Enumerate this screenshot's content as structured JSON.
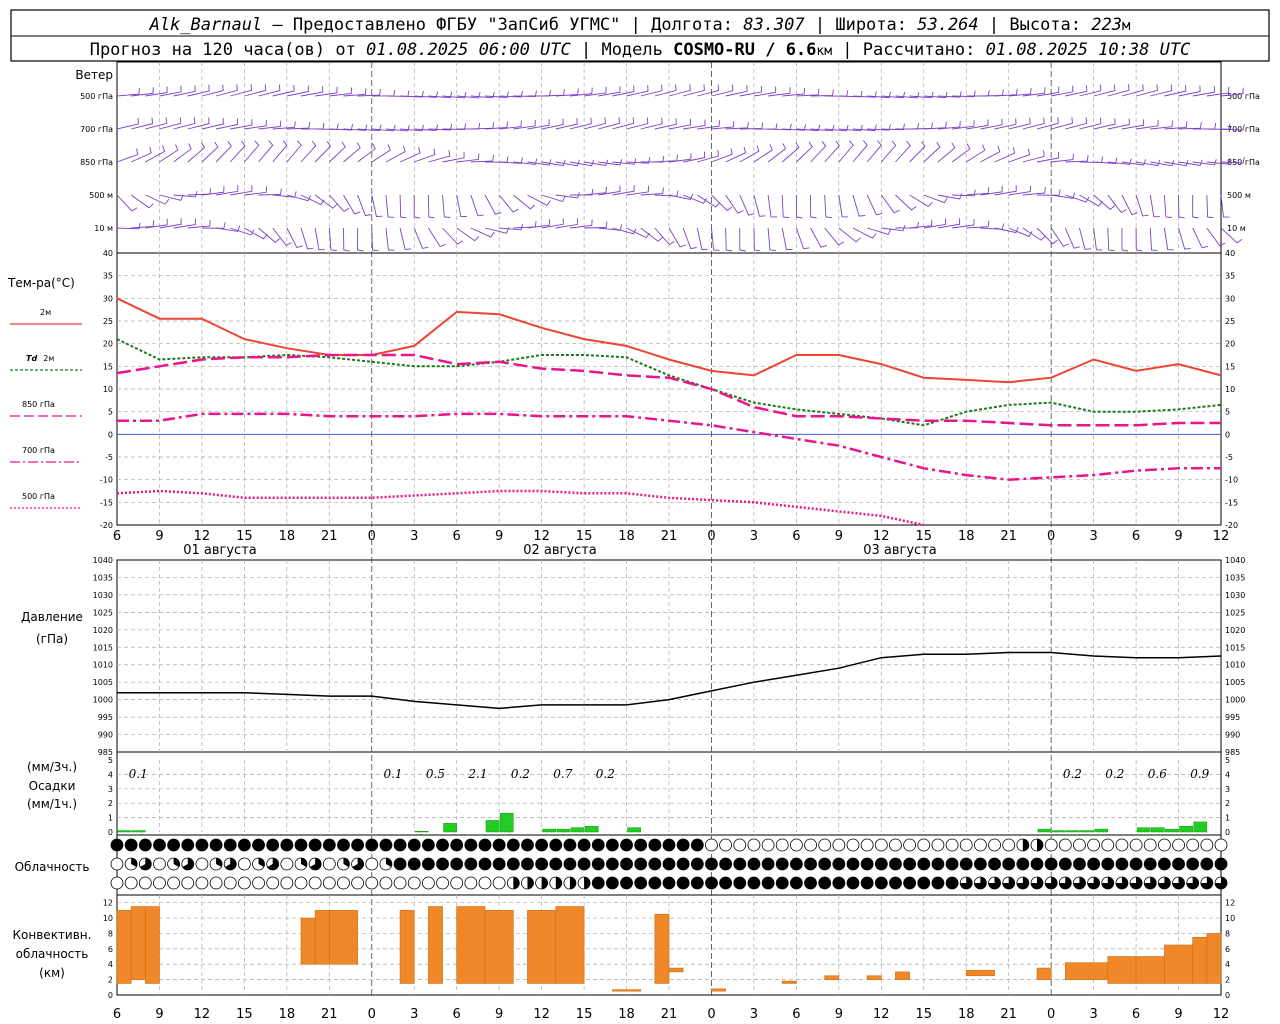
{
  "header": {
    "line1": {
      "station": "Alk_Barnaul",
      "provider": " – Предоставлено ФГБУ \"ЗапСиб УГМС\" | Долгота: ",
      "lon": "83.307",
      "lat_label": " | Широта: ",
      "lat": "53.264",
      "alt_label": " | Высота: ",
      "alt": "223",
      "alt_unit": "м"
    },
    "line2": {
      "prefix": "Прогноз на 120 часа(ов) от ",
      "from": "01.08.2025 06:00 UTC",
      "model_label": " | Модель ",
      "model": "COSMO-RU / 6.6",
      "model_unit": "км",
      "calc_label": " | Рассчитано: ",
      "calc": "01.08.2025 10:38 UTC"
    }
  },
  "labels": {
    "wind": "Ветер",
    "wind_levels": [
      "500 гПа",
      "700 гПа",
      "850 гПа",
      "500  м",
      "10   м"
    ],
    "temp": "Тем-ра(°С)",
    "t2m": "2м",
    "td2m_a": "Td",
    "td2m_b": "2м",
    "t850": "850 гПа",
    "t700": "700 гПа",
    "t500": "500 гПа",
    "pressure_a": "Давление",
    "pressure_b": "(гПа)",
    "precip_a": "(мм/3ч.)",
    "precip_b": "Осадки",
    "precip_c": "(мм/1ч.)",
    "cloud": "Облачность",
    "conv_a": "Конвективн.",
    "conv_b": "облачность",
    "conv_c": "(км)",
    "dates": [
      "01 августа",
      "02 августа",
      "03 августа"
    ]
  },
  "colors": {
    "wind": "#7b3fc4",
    "t2m": "#ee4433",
    "td2m": "#1a7a1a",
    "t850": "#e8168a",
    "t700": "#e8168a",
    "t500": "#e8168a",
    "zero": "#3344cc",
    "pressure": "#000000",
    "precip": "#22cc22",
    "conv": "#f0882a"
  },
  "chart_data": [
    {
      "type": "line",
      "id": "temperature",
      "ylim": [
        -20,
        40
      ],
      "yticks": [
        40,
        35,
        30,
        25,
        20,
        15,
        10,
        5,
        0,
        -5,
        -10,
        -15,
        -20
      ],
      "x_hours": [
        0,
        3,
        6,
        9,
        12,
        15,
        18,
        21,
        24,
        27,
        30,
        33,
        36,
        39,
        42,
        45,
        48,
        51,
        54,
        57,
        60,
        63,
        66,
        69,
        72,
        75,
        78
      ],
      "x_tick_labels": [
        "6",
        "9",
        "12",
        "15",
        "18",
        "21",
        "0",
        "3",
        "6",
        "9",
        "12",
        "15",
        "18",
        "21",
        "0",
        "3",
        "6",
        "9",
        "12",
        "15",
        "18",
        "21",
        "0",
        "3",
        "6",
        "9",
        "12"
      ],
      "series": [
        {
          "name": "2м",
          "values": [
            30,
            25.5,
            25.5,
            21,
            19,
            17.5,
            17.5,
            19.5,
            27,
            26.5,
            23.5,
            21,
            19.5,
            16.5,
            14,
            13,
            17.5,
            17.5,
            15.5,
            12.5,
            12,
            11.5,
            12.5,
            16.5,
            14,
            15.5,
            13
          ]
        },
        {
          "name": "Td 2м",
          "values": [
            21,
            16.5,
            17,
            17,
            17.5,
            17,
            16,
            15,
            15,
            16,
            17.5,
            17.5,
            17,
            13,
            10,
            7,
            5.5,
            4.5,
            3.5,
            2,
            5,
            6.5,
            7,
            5,
            5,
            5.5,
            6.5
          ]
        },
        {
          "name": "850 гПа",
          "values": [
            13.5,
            15,
            16.5,
            17,
            17,
            17.5,
            17.5,
            17.5,
            15.5,
            16,
            14.5,
            14,
            13,
            12.5,
            10,
            6,
            4,
            4,
            3.5,
            3,
            3,
            2.5,
            2,
            2,
            2,
            2.5,
            2.5
          ]
        },
        {
          "name": "700 гПа",
          "values": [
            3,
            3,
            4.5,
            4.5,
            4.5,
            4,
            4,
            4,
            4.5,
            4.5,
            4,
            4,
            4,
            3,
            2,
            0.5,
            -1,
            -2.5,
            -5,
            -7.5,
            -9,
            -10,
            -9.5,
            -9,
            -8,
            -7.5,
            -7.5
          ]
        },
        {
          "name": "500 гПа",
          "values": [
            -13,
            -12.5,
            -13,
            -14,
            -14,
            -14,
            -14,
            -13.5,
            -13,
            -12.5,
            -12.5,
            -13,
            -13,
            -14,
            -14.5,
            -15,
            -16,
            -17,
            -18,
            -20
          ]
        }
      ]
    },
    {
      "type": "line",
      "id": "pressure",
      "ylim": [
        985,
        1040
      ],
      "yticks": [
        1040,
        1035,
        1030,
        1025,
        1020,
        1015,
        1010,
        1005,
        1000,
        995,
        990,
        985
      ],
      "x_hours": [
        0,
        3,
        6,
        9,
        12,
        15,
        18,
        21,
        24,
        27,
        30,
        33,
        36,
        39,
        42,
        45,
        48,
        51,
        54,
        57,
        60,
        63,
        66,
        69,
        72,
        75,
        78
      ],
      "series": [
        {
          "name": "Давление",
          "values": [
            1002,
            1002,
            1002,
            1002,
            1001.5,
            1001,
            1001,
            999.5,
            998.5,
            997.5,
            998.5,
            998.5,
            998.5,
            1000,
            1002.5,
            1005,
            1007,
            1009,
            1012,
            1013,
            1013,
            1013.5,
            1013.5,
            1012.5,
            1012,
            1012,
            1012.5
          ]
        }
      ]
    },
    {
      "type": "bar",
      "id": "precipitation",
      "ylim": [
        0,
        5
      ],
      "yticks": [
        5,
        4,
        3,
        2,
        1,
        0
      ],
      "labels_3h": [
        "0.1",
        "0.1",
        "0.5",
        "2.1",
        "0.2",
        "0.7",
        "0.2",
        "0.2",
        "0.2",
        "0.6",
        "0.9"
      ],
      "labels_3h_hours": [
        1.5,
        19.5,
        22.5,
        25.5,
        28.5,
        31.5,
        34.5,
        67.5,
        70.5,
        73.5,
        76.5
      ],
      "hourly": [
        {
          "h": 1,
          "v": 0.1
        },
        {
          "h": 2,
          "v": 0.1
        },
        {
          "h": 22,
          "v": 0.05
        },
        {
          "h": 24,
          "v": 0.6
        },
        {
          "h": 27,
          "v": 0.8
        },
        {
          "h": 28,
          "v": 1.3
        },
        {
          "h": 31,
          "v": 0.2
        },
        {
          "h": 32,
          "v": 0.2
        },
        {
          "h": 33,
          "v": 0.3
        },
        {
          "h": 34,
          "v": 0.4
        },
        {
          "h": 37,
          "v": 0.3
        },
        {
          "h": 66,
          "v": 0.2
        },
        {
          "h": 67,
          "v": 0.1
        },
        {
          "h": 68,
          "v": 0.1
        },
        {
          "h": 69,
          "v": 0.1
        },
        {
          "h": 70,
          "v": 0.2
        },
        {
          "h": 73,
          "v": 0.3
        },
        {
          "h": 74,
          "v": 0.3
        },
        {
          "h": 75,
          "v": 0.2
        },
        {
          "h": 76,
          "v": 0.4
        },
        {
          "h": 77,
          "v": 0.7
        }
      ]
    },
    {
      "type": "bar",
      "id": "convective_cloud",
      "ylim": [
        0,
        13
      ],
      "yticks": [
        12,
        10,
        8,
        6,
        4,
        2,
        0
      ],
      "bars": [
        {
          "from": 0,
          "to": 1,
          "low": 1.5,
          "high": 11
        },
        {
          "from": 1,
          "to": 2,
          "low": 2,
          "high": 11.5
        },
        {
          "from": 2,
          "to": 3,
          "low": 1.5,
          "high": 11.5
        },
        {
          "from": 13,
          "to": 14,
          "low": 4,
          "high": 10
        },
        {
          "from": 14,
          "to": 15,
          "low": 4,
          "high": 11
        },
        {
          "from": 15,
          "to": 17,
          "low": 4,
          "high": 11
        },
        {
          "from": 20,
          "to": 21,
          "low": 1.5,
          "high": 11
        },
        {
          "from": 22,
          "to": 23,
          "low": 1.5,
          "high": 11.5
        },
        {
          "from": 24,
          "to": 26,
          "low": 1.5,
          "high": 11.5
        },
        {
          "from": 26,
          "to": 28,
          "low": 1.5,
          "high": 11
        },
        {
          "from": 29,
          "to": 31,
          "low": 1.5,
          "high": 11
        },
        {
          "from": 31,
          "to": 33,
          "low": 1.5,
          "high": 11.5
        },
        {
          "from": 35,
          "to": 37,
          "low": 0.5,
          "high": 0.7
        },
        {
          "from": 38,
          "to": 39,
          "low": 1.5,
          "high": 10.5
        },
        {
          "from": 39,
          "to": 40,
          "low": 3,
          "high": 3.5
        },
        {
          "from": 42,
          "to": 43,
          "low": 0.5,
          "high": 0.8
        },
        {
          "from": 47,
          "to": 48,
          "low": 1.5,
          "high": 1.8
        },
        {
          "from": 50,
          "to": 51,
          "low": 2,
          "high": 2.5
        },
        {
          "from": 53,
          "to": 54,
          "low": 2,
          "high": 2.5
        },
        {
          "from": 55,
          "to": 56,
          "low": 2,
          "high": 3
        },
        {
          "from": 60,
          "to": 62,
          "low": 2.5,
          "high": 3.2
        },
        {
          "from": 65,
          "to": 66,
          "low": 2,
          "high": 3.5
        },
        {
          "from": 67,
          "to": 70,
          "low": 2,
          "high": 4.2
        },
        {
          "from": 70,
          "to": 72,
          "low": 1.5,
          "high": 5
        },
        {
          "from": 72,
          "to": 74,
          "low": 1.5,
          "high": 5
        },
        {
          "from": 74,
          "to": 76,
          "low": 1.5,
          "high": 6.5
        },
        {
          "from": 76,
          "to": 77,
          "low": 1.5,
          "high": 7.5
        },
        {
          "from": 77,
          "to": 78,
          "low": 1.5,
          "high": 8
        }
      ]
    }
  ]
}
